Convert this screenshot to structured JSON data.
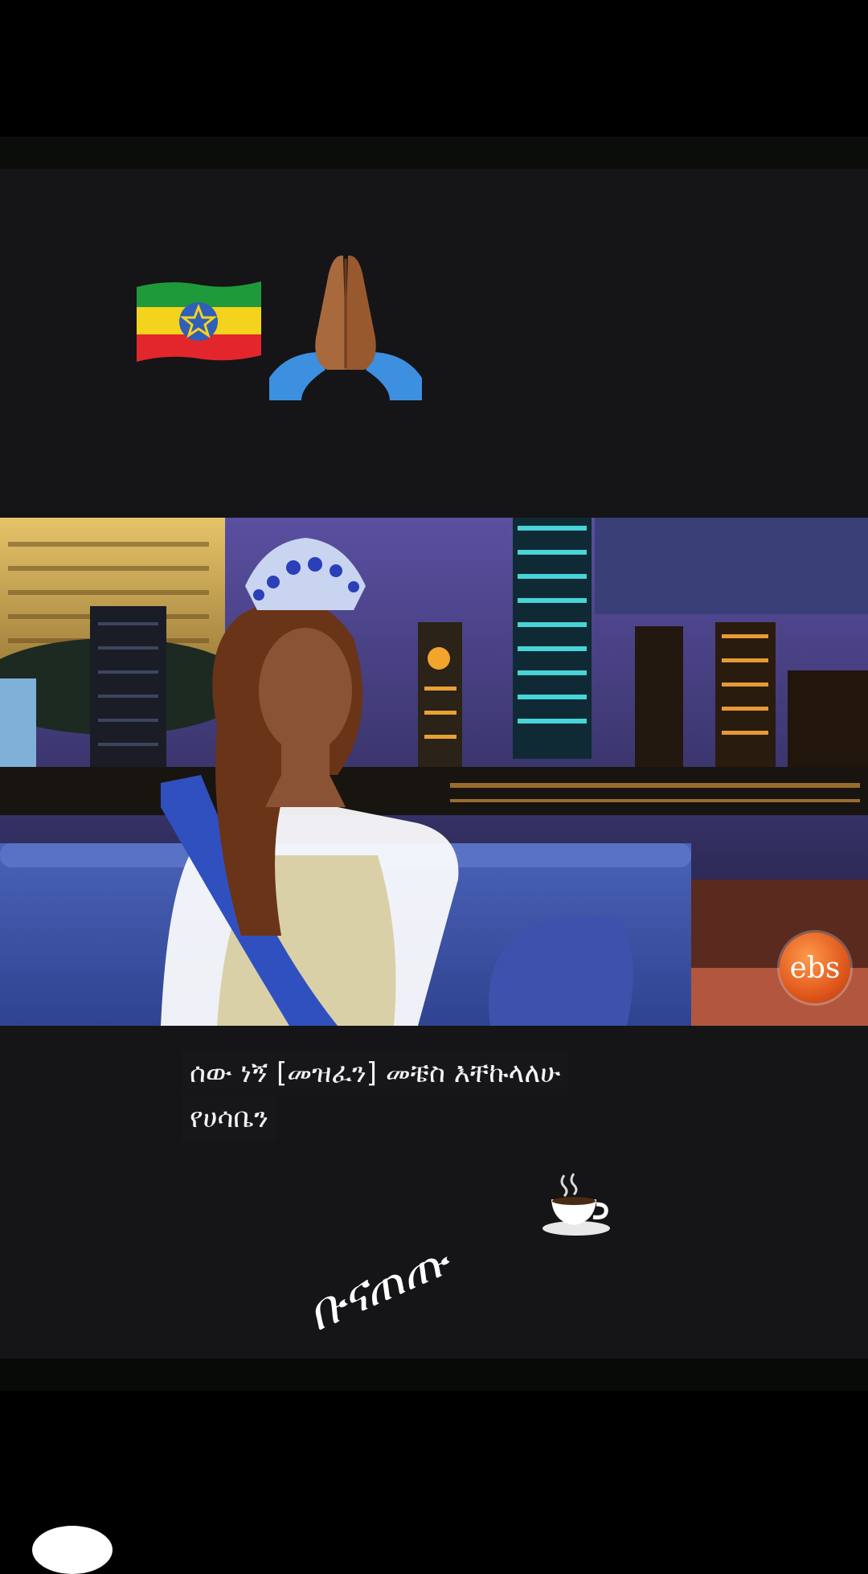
{
  "story": {
    "stickers": {
      "flag_icon": "ethiopia-flag-icon",
      "hands_icon": "folded-hands-icon"
    },
    "video": {
      "channel_logo": "ebs",
      "subtitle_line_1": "ሰው ነኝ [መዝፈን] መቼስ እቸኩላለሁ",
      "subtitle_line_2": "የሀሳቤን"
    },
    "handwritten_text": "ቡናጠጡ",
    "coffee_icon": "hot-beverage-icon"
  },
  "colors": {
    "background": "#151417",
    "subtitle_bg": "#18181a",
    "logo_orange": "#e0581c",
    "sofa_blue": "#3d55a8"
  }
}
